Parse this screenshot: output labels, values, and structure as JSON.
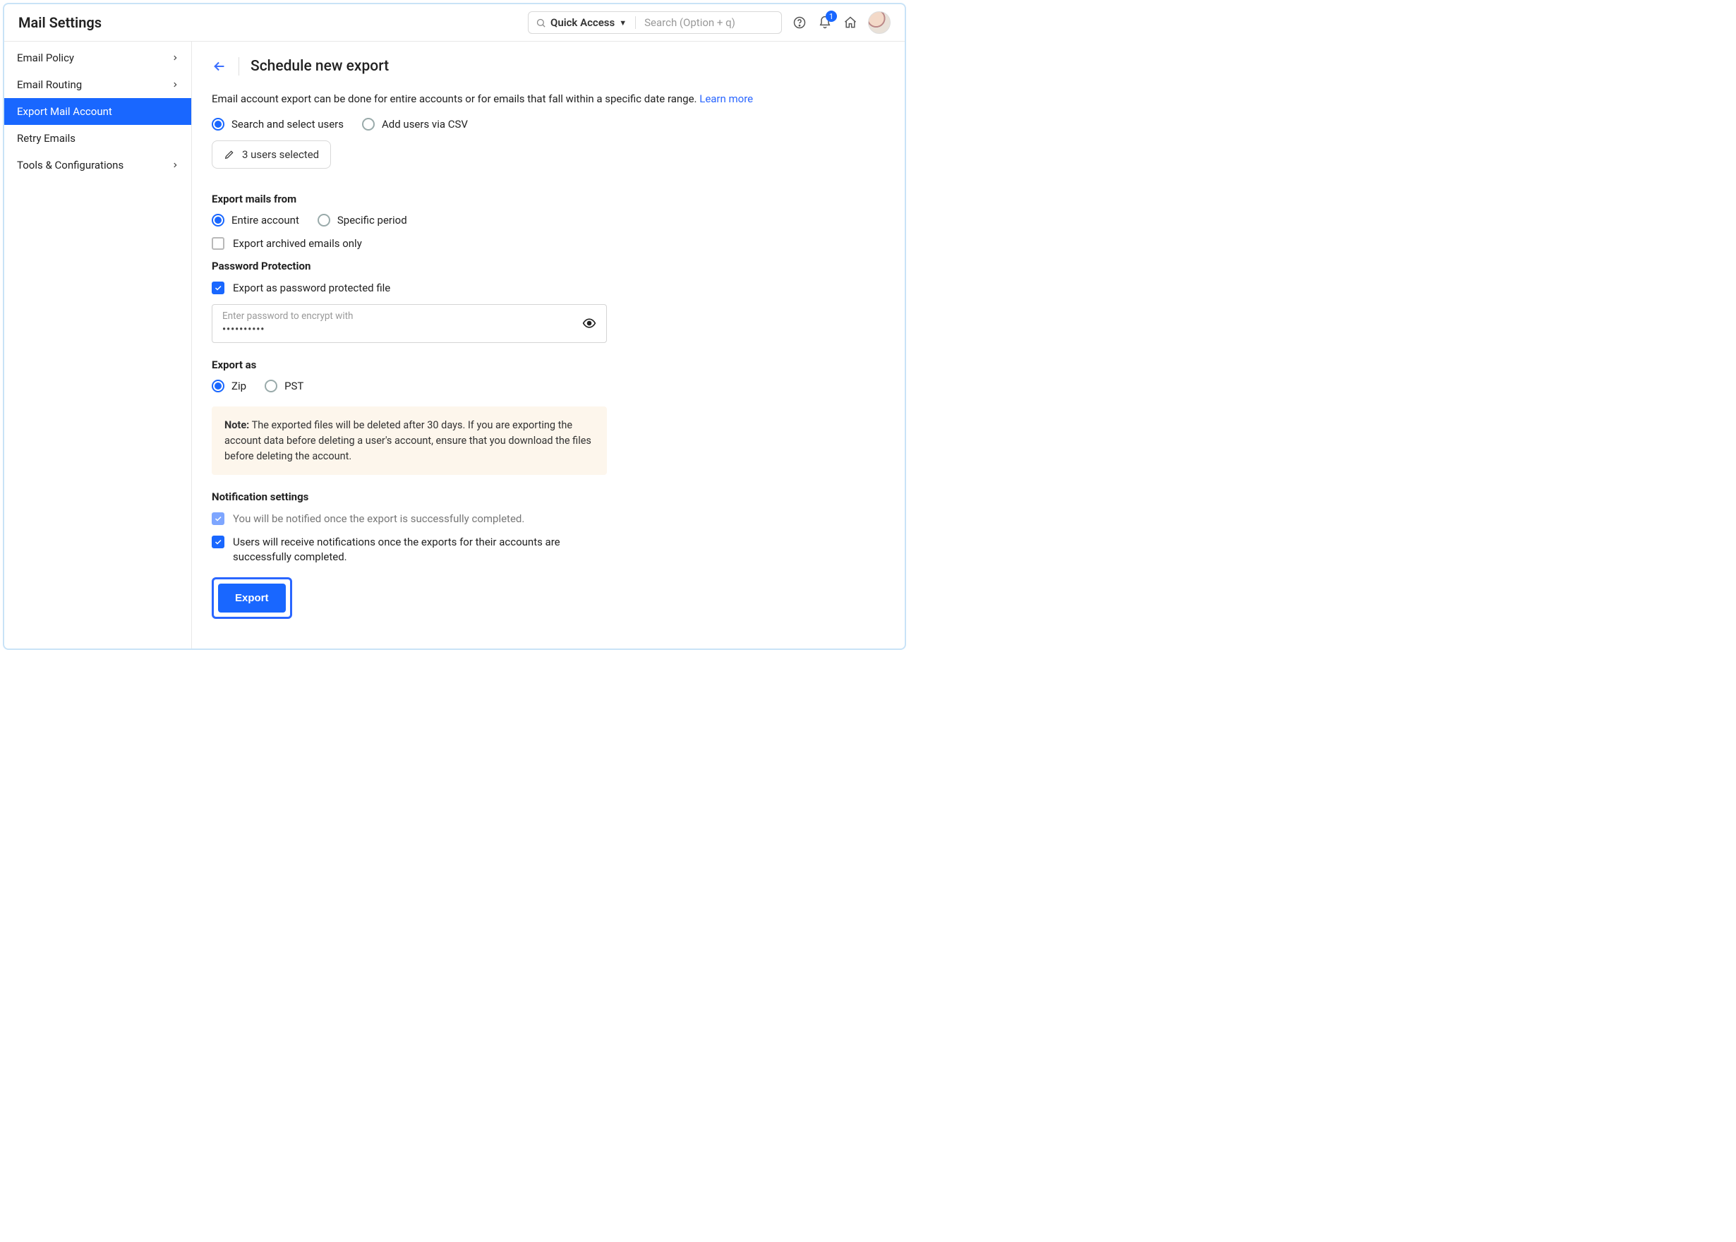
{
  "topbar": {
    "title": "Mail Settings",
    "quick_access_label": "Quick Access",
    "search_placeholder": "Search (Option + q)",
    "notification_count": "1"
  },
  "sidebar": {
    "items": [
      {
        "label": "Email Policy",
        "has_children": true,
        "active": false
      },
      {
        "label": "Email Routing",
        "has_children": true,
        "active": false
      },
      {
        "label": "Export Mail Account",
        "has_children": false,
        "active": true
      },
      {
        "label": "Retry Emails",
        "has_children": false,
        "active": false
      },
      {
        "label": "Tools & Configurations",
        "has_children": true,
        "active": false
      }
    ]
  },
  "page": {
    "title": "Schedule new export",
    "description": "Email account export can be done for entire accounts or for emails that fall within a specific date range.  ",
    "learn_more": "Learn more",
    "user_mode": {
      "search_label": "Search and select users",
      "csv_label": "Add users via CSV",
      "selected": "search"
    },
    "users_selected_label": "3 users selected",
    "export_from": {
      "heading": "Export mails from",
      "entire_label": "Entire account",
      "period_label": "Specific period",
      "selected": "entire",
      "archived_label": "Export archived emails only",
      "archived_checked": false
    },
    "password": {
      "heading": "Password Protection",
      "protect_label": "Export as password protected file",
      "protect_checked": true,
      "field_label": "Enter password to encrypt with",
      "masked_value": "••••••••••"
    },
    "export_as": {
      "heading": "Export as",
      "zip_label": "Zip",
      "pst_label": "PST",
      "selected": "zip"
    },
    "note": {
      "prefix": "Note:",
      "body": " The exported files will be deleted after 30 days. If you are exporting the account data before deleting a user's account, ensure that you download the files before deleting the account."
    },
    "notifications": {
      "heading": "Notification settings",
      "self_label": "You will be notified once the export is successfully completed.",
      "users_label": "Users will receive notifications once the exports for their accounts are successfully completed."
    },
    "export_button": "Export"
  }
}
